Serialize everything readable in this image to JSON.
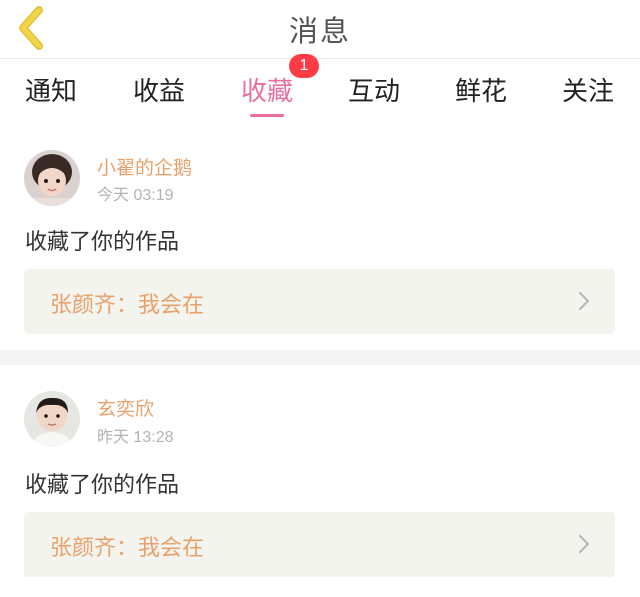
{
  "header": {
    "title": "消息"
  },
  "tabs": [
    {
      "label": "通知",
      "active": false
    },
    {
      "label": "收益",
      "active": false
    },
    {
      "label": "收藏",
      "active": true,
      "badge": "1"
    },
    {
      "label": "互动",
      "active": false
    },
    {
      "label": "鲜花",
      "active": false
    },
    {
      "label": "关注",
      "active": false
    }
  ],
  "messages": [
    {
      "username": "小翟的企鹅",
      "time": "今天 03:19",
      "action": "收藏了你的作品",
      "work_title": "张颜齐：我会在"
    },
    {
      "username": "玄奕欣",
      "time": "昨天 13:28",
      "action": "收藏了你的作品",
      "work_title": "张颜齐：我会在"
    }
  ],
  "colors": {
    "accent_pink": "#e8709f",
    "username_orange": "#e8a16b",
    "badge_red": "#ff3b46",
    "back_yellow": "#f2d34a"
  },
  "icons": {
    "back": "chevron-left-icon",
    "row_arrow": "chevron-right-icon"
  }
}
